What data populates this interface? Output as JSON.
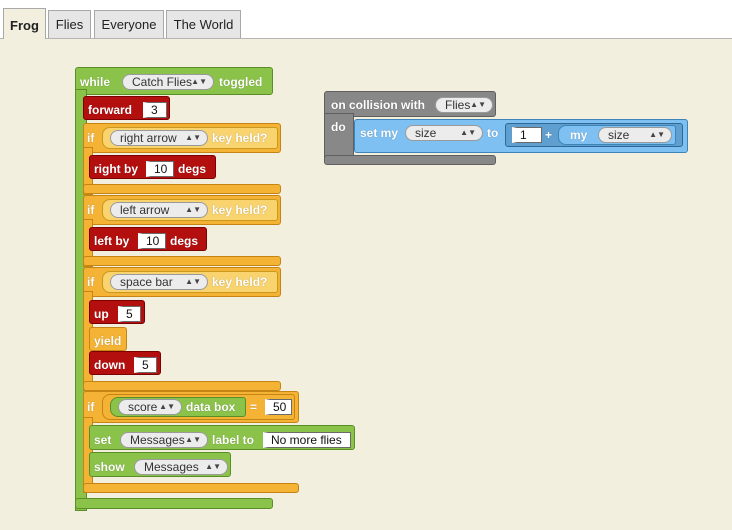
{
  "tabs": [
    {
      "label": "Frog",
      "active": true
    },
    {
      "label": "Flies",
      "active": false
    },
    {
      "label": "Everyone",
      "active": false
    },
    {
      "label": "The World",
      "active": false
    }
  ],
  "while_block": {
    "keyword": "while",
    "event": "Catch Flies",
    "suffix": "toggled"
  },
  "forward_block": {
    "label": "forward",
    "value": "3"
  },
  "if1": {
    "keyword": "if",
    "key": "right arrow",
    "suffix": "key held?",
    "body": {
      "label": "right by",
      "value": "10",
      "unit": "degs"
    }
  },
  "if2": {
    "keyword": "if",
    "key": "left arrow",
    "suffix": "key held?",
    "body": {
      "label": "left by",
      "value": "10",
      "unit": "degs"
    }
  },
  "if3": {
    "keyword": "if",
    "key": "space bar",
    "suffix": "key held?",
    "up": {
      "label": "up",
      "value": "5"
    },
    "yield": "yield",
    "down": {
      "label": "down",
      "value": "5"
    }
  },
  "if4": {
    "keyword": "if",
    "var": "score",
    "data_box": "data box",
    "op": "=",
    "value": "50",
    "set": {
      "label": "set",
      "target": "Messages",
      "label_to": "label to",
      "text": "No more flies"
    },
    "show": {
      "label": "show",
      "target": "Messages"
    }
  },
  "collision": {
    "prefix": "on collision with",
    "target": "Flies",
    "do": "do",
    "set": {
      "label": "set my",
      "prop": "size",
      "to": "to",
      "value": "1",
      "op": "+",
      "my": "my",
      "prop2": "size"
    }
  },
  "colors": {
    "control": "#f5b335",
    "sensing": "#f9d36e",
    "event": "#8bc34a",
    "motion": "#b40f0f",
    "collision": "#888888",
    "traits": "#7ec0f2"
  }
}
